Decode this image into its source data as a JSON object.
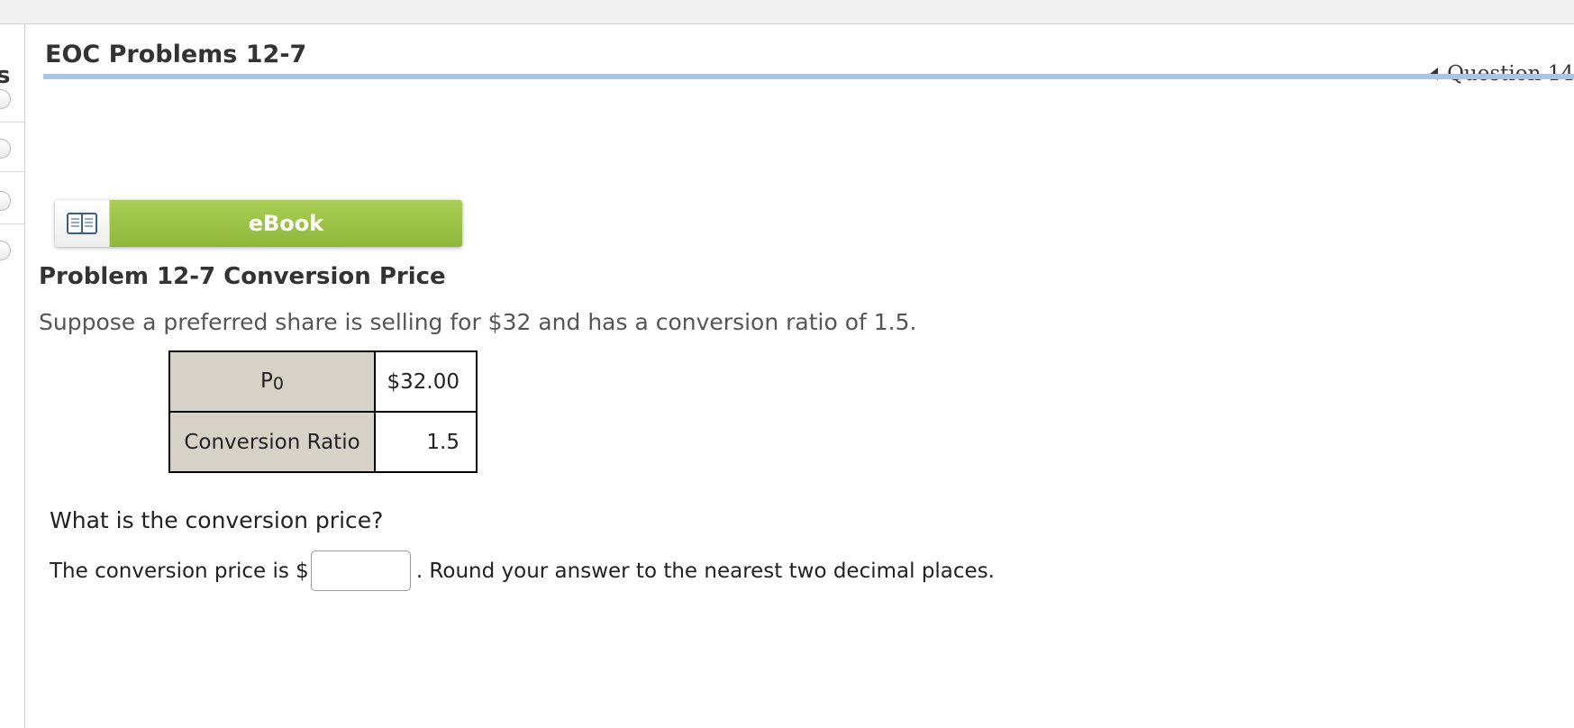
{
  "window": {
    "left_cut_text": "s"
  },
  "header": {
    "title": "EOC Problems 12-7",
    "question_nav": "Question 14"
  },
  "sidebar": {
    "items": [
      {
        "state": "unanswered"
      },
      {
        "state": "unanswered"
      },
      {
        "state": "unanswered"
      },
      {
        "state": "unanswered"
      }
    ]
  },
  "ebook": {
    "label": "eBook",
    "icon": "book-icon"
  },
  "problem": {
    "title": "Problem 12-7 Conversion Price",
    "text": "Suppose a preferred share is selling for $32 and has a conversion ratio of 1.5.",
    "table": {
      "rows": [
        {
          "label_main": "P",
          "label_sub": "0",
          "value": "$32.00"
        },
        {
          "label_main": "Conversion Ratio",
          "label_sub": "",
          "value": "1.5"
        }
      ]
    },
    "question": "What is the conversion price?",
    "answer_prefix": "The conversion price is $",
    "answer_value": "",
    "answer_suffix": ". Round your answer to the nearest two decimal places."
  },
  "colors": {
    "ebook_green": "#9bc34a",
    "header_underline": "#a9c4e6",
    "table_label_bg": "#d6d2c8"
  }
}
